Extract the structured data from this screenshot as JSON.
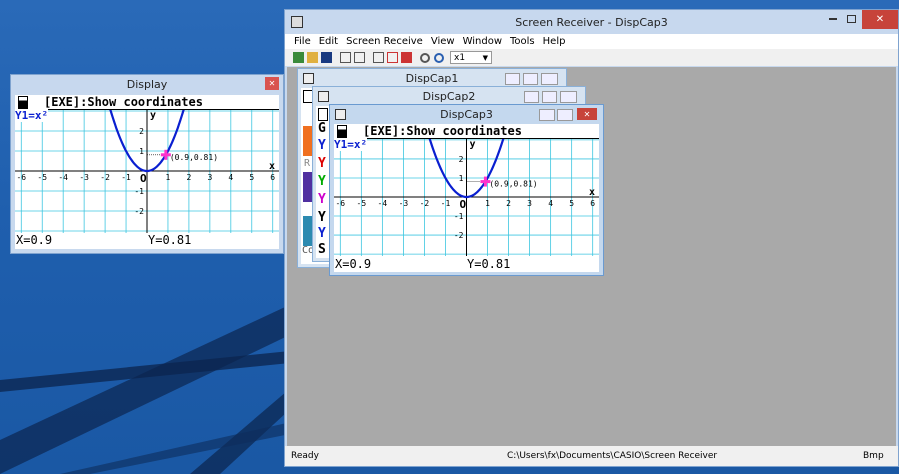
{
  "display_window": {
    "title": "Display",
    "close_glyph": "✕",
    "screen": {
      "header": "[EXE]:Show coordinates",
      "function_label": "Y1=x²",
      "point_label": "(0.9,0.81)",
      "x_value": "X=0.9",
      "y_value": "Y=0.81",
      "x_axis_name": "x",
      "y_axis_name": "y",
      "origin": "O",
      "x_ticks": [
        "-6",
        "-5",
        "-4",
        "-3",
        "-2",
        "-1",
        "1",
        "2",
        "3",
        "4",
        "5",
        "6"
      ],
      "y_ticks": [
        "2",
        "1",
        "-1",
        "-2"
      ]
    }
  },
  "main_window": {
    "title": "Screen Receiver - DispCap3",
    "menu": [
      "File",
      "Edit",
      "Screen Receive",
      "View",
      "Window",
      "Tools",
      "Help"
    ],
    "zoom_value": "x1",
    "status_left": "Ready",
    "status_path": "C:\\Users\\fx\\Documents\\CASIO\\Screen Receiver",
    "status_format": "Bmp"
  },
  "child_windows": {
    "dispcap1_title": "DispCap1",
    "dispcap2_title": "DispCap2",
    "dispcap3_title": "DispCap3",
    "dispcap1_letters": [
      "R",
      "Co"
    ],
    "dispcap2_letters": [
      "G",
      "Y",
      "Y",
      "Y",
      "Y",
      "Y",
      "Y",
      "S"
    ]
  },
  "colors": {
    "curve": "#0a1fd0",
    "grid": "#3cc6e0",
    "point_marker": "#ff33cc",
    "title_active": "#b9d1ea"
  }
}
